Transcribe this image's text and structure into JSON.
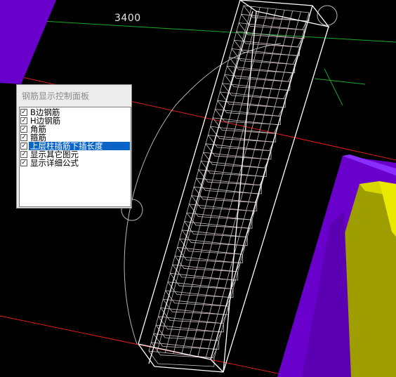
{
  "viewport": {
    "dimension_label": "3400",
    "colors": {
      "background": "#000000",
      "rebar_wire": "#c8bcbc",
      "column_outline": "#ffffff",
      "axis_red": "#e01a1a",
      "axis_green": "#1aa82a",
      "purple_block": "#6a00cc",
      "yellow_block": "#9e9e00"
    }
  },
  "panel": {
    "title": "钢筋显示控制面板",
    "options": [
      {
        "label": "B边钢筋",
        "checked": true,
        "selected": false
      },
      {
        "label": "H边钢筋",
        "checked": true,
        "selected": false
      },
      {
        "label": "角筋",
        "checked": true,
        "selected": false
      },
      {
        "label": "箍筋",
        "checked": true,
        "selected": false
      },
      {
        "label": "上层柱插筋下插长度",
        "checked": true,
        "selected": true
      },
      {
        "label": "显示其它图元",
        "checked": true,
        "selected": false
      },
      {
        "label": "显示详细公式",
        "checked": true,
        "selected": false
      }
    ]
  }
}
